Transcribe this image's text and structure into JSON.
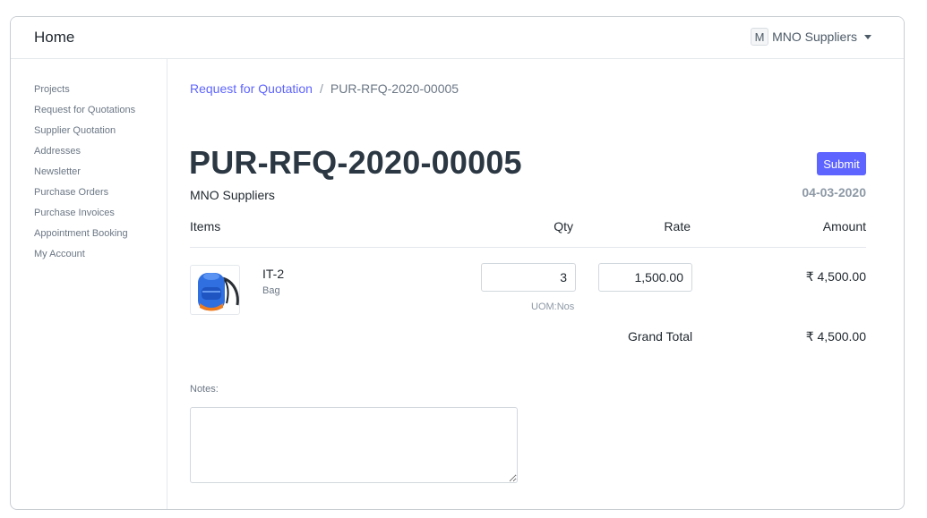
{
  "navbar": {
    "brand": "Home",
    "user": {
      "avatar_letter": "M",
      "name": "MNO Suppliers"
    }
  },
  "sidebar": {
    "items": [
      {
        "label": "Projects"
      },
      {
        "label": "Request for Quotations"
      },
      {
        "label": "Supplier Quotation"
      },
      {
        "label": "Addresses"
      },
      {
        "label": "Newsletter"
      },
      {
        "label": "Purchase Orders"
      },
      {
        "label": "Purchase Invoices"
      },
      {
        "label": "Appointment Booking"
      },
      {
        "label": "My Account"
      }
    ]
  },
  "breadcrumb": {
    "parent": "Request for Quotation",
    "separator": "/",
    "current": "PUR-RFQ-2020-00005"
  },
  "document": {
    "title": "PUR-RFQ-2020-00005",
    "supplier": "MNO Suppliers",
    "date": "04-03-2020",
    "submit_label": "Submit"
  },
  "table": {
    "headers": {
      "items": "Items",
      "qty": "Qty",
      "rate": "Rate",
      "amount": "Amount"
    },
    "rows": [
      {
        "code": "IT-2",
        "name": "Bag",
        "image_icon": "backpack-icon",
        "qty": "3",
        "uom": "UOM:Nos",
        "rate": "1,500.00",
        "amount": "₹ 4,500.00"
      }
    ],
    "grand_total_label": "Grand Total",
    "grand_total": "₹ 4,500.00"
  },
  "notes": {
    "label": "Notes:",
    "value": ""
  },
  "colors": {
    "accent": "#5e64ff",
    "text": "#1f272e",
    "muted": "#8d99a6",
    "border": "#d1d8dd",
    "backpack_blue": "#2f6fe0",
    "backpack_orange": "#f07c1e"
  }
}
